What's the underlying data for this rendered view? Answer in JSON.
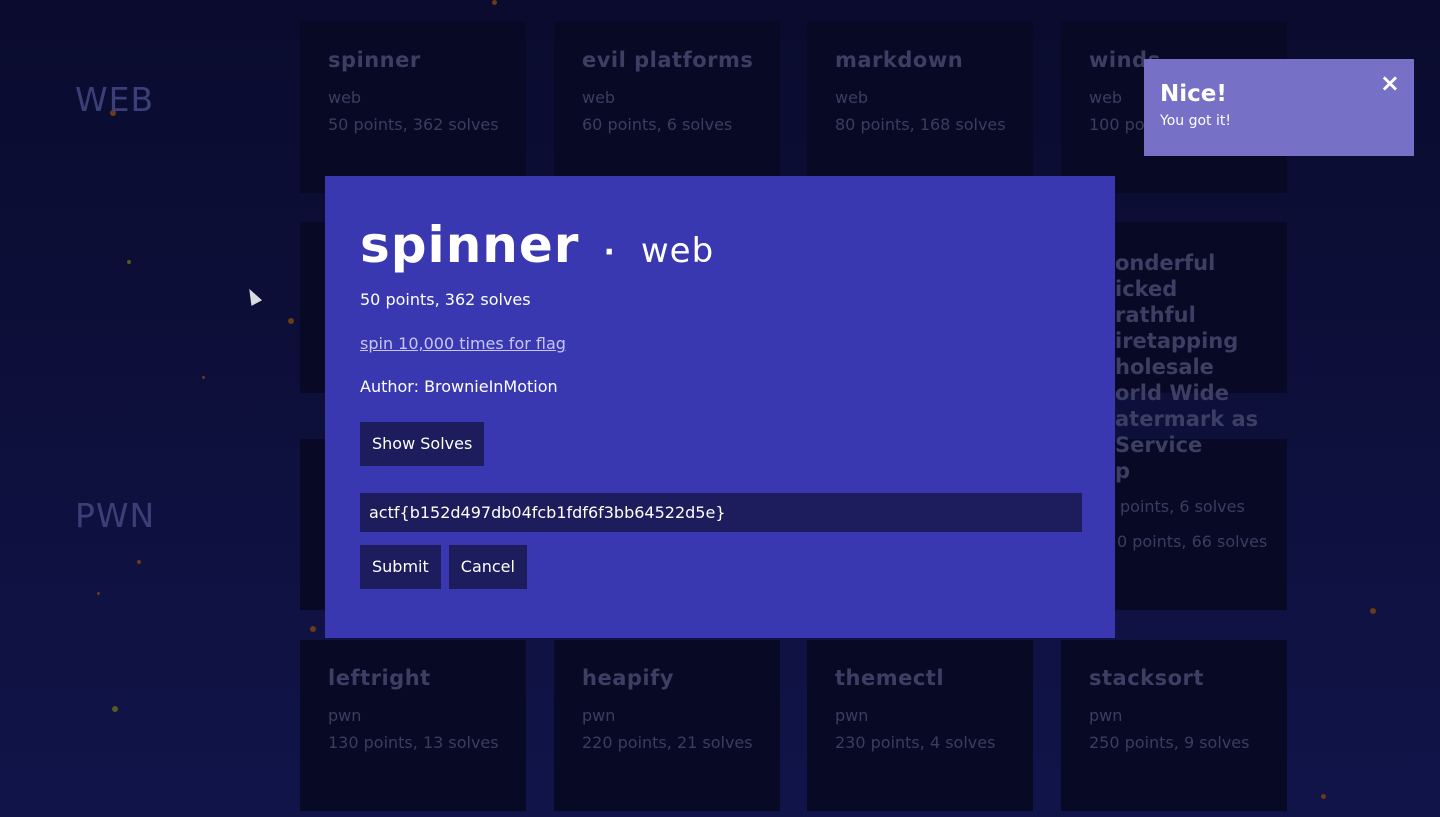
{
  "categories": {
    "web": "WEB",
    "pwn": "PWN"
  },
  "web_cards": [
    {
      "title": "spinner",
      "category": "web",
      "stats": "50 points, 362 solves"
    },
    {
      "title": "evil platforms",
      "category": "web",
      "stats": "60 points, 6 solves"
    },
    {
      "title": "markdown",
      "category": "web",
      "stats": "80 points, 168 solves"
    },
    {
      "title": "winds",
      "category": "web",
      "stats": "100 points, 4 solves"
    }
  ],
  "wonderful_card": {
    "title": "onderful\nicked\nrathful\niretapping\nholesale\norld Wide\natermark as\nService\np",
    "stats_partial": "points, 6 solves",
    "stats_partial2": "0 points, 66 solves"
  },
  "pwn_cards": [
    {
      "title": "leftright",
      "category": "pwn",
      "stats": "130 points, 13 solves"
    },
    {
      "title": "heapify",
      "category": "pwn",
      "stats": "220 points, 21 solves"
    },
    {
      "title": "themectl",
      "category": "pwn",
      "stats": "230 points, 4 solves"
    },
    {
      "title": "stacksort",
      "category": "pwn",
      "stats": "250 points, 9 solves"
    }
  ],
  "modal": {
    "title": "spinner",
    "separator": "·",
    "category": "web",
    "stats": "50 points, 362 solves",
    "description_link": "spin 10,000 times for flag",
    "author": "Author: BrownieInMotion",
    "show_solves_label": "Show Solves",
    "flag_value": "actf{b152d497db04fcb1fdf6f3bb64522d5e}",
    "submit_label": "Submit",
    "cancel_label": "Cancel"
  },
  "toast": {
    "title": "Nice!",
    "message": "You got it!",
    "close_icon": "×"
  },
  "colors": {
    "background": "#0e0f38",
    "card": "#080924",
    "modal": "#3a38b1",
    "button": "#1d1c5c",
    "toast": "#7670c6"
  }
}
